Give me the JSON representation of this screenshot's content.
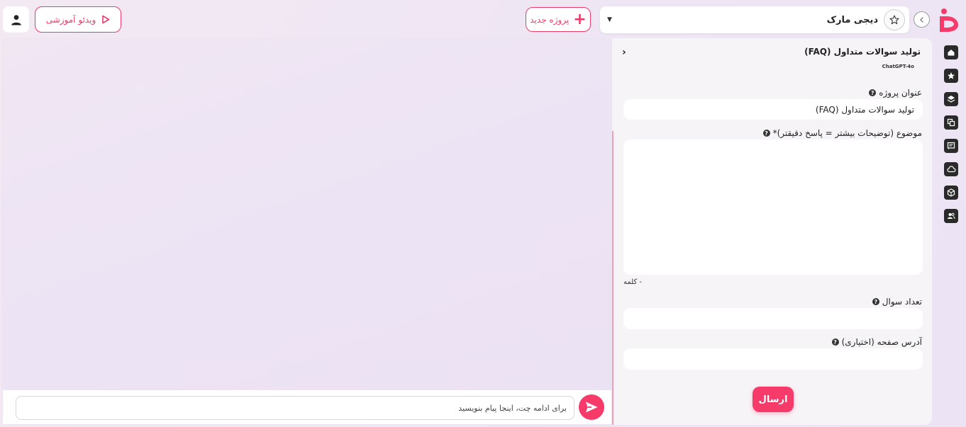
{
  "header": {
    "project_name": "دیجی مارک",
    "new_project_label": "پروژه جدید",
    "video_label": "ویدئو آموزشی"
  },
  "sidebar": {
    "items": [
      {
        "icon": "home-icon"
      },
      {
        "icon": "star-icon"
      },
      {
        "icon": "layers-icon"
      },
      {
        "icon": "copy-icon"
      },
      {
        "icon": "chat-icon"
      },
      {
        "icon": "cloud-icon"
      },
      {
        "icon": "cube-icon"
      },
      {
        "icon": "users-icon"
      }
    ]
  },
  "form": {
    "title": "تولید سوالات متداول (FAQ)",
    "model": "ChatGPT-4o",
    "project_title_label": "عنوان پروژه",
    "project_title_value": "تولید سوالات متداول (FAQ)",
    "topic_label": "موضوع (توضیحات بیشتر = پاسخ دقیقتر)*",
    "word_count": "- کلمه",
    "question_count_label": "تعداد سوال",
    "page_url_label": "آدرس صفحه (اختیاری)",
    "submit_label": "ارسال"
  },
  "chat": {
    "input_placeholder": "برای ادامه چت، اینجا پیام بنویسید"
  },
  "colors": {
    "accent": "#f63a6a",
    "dark": "#2a2a2a"
  }
}
